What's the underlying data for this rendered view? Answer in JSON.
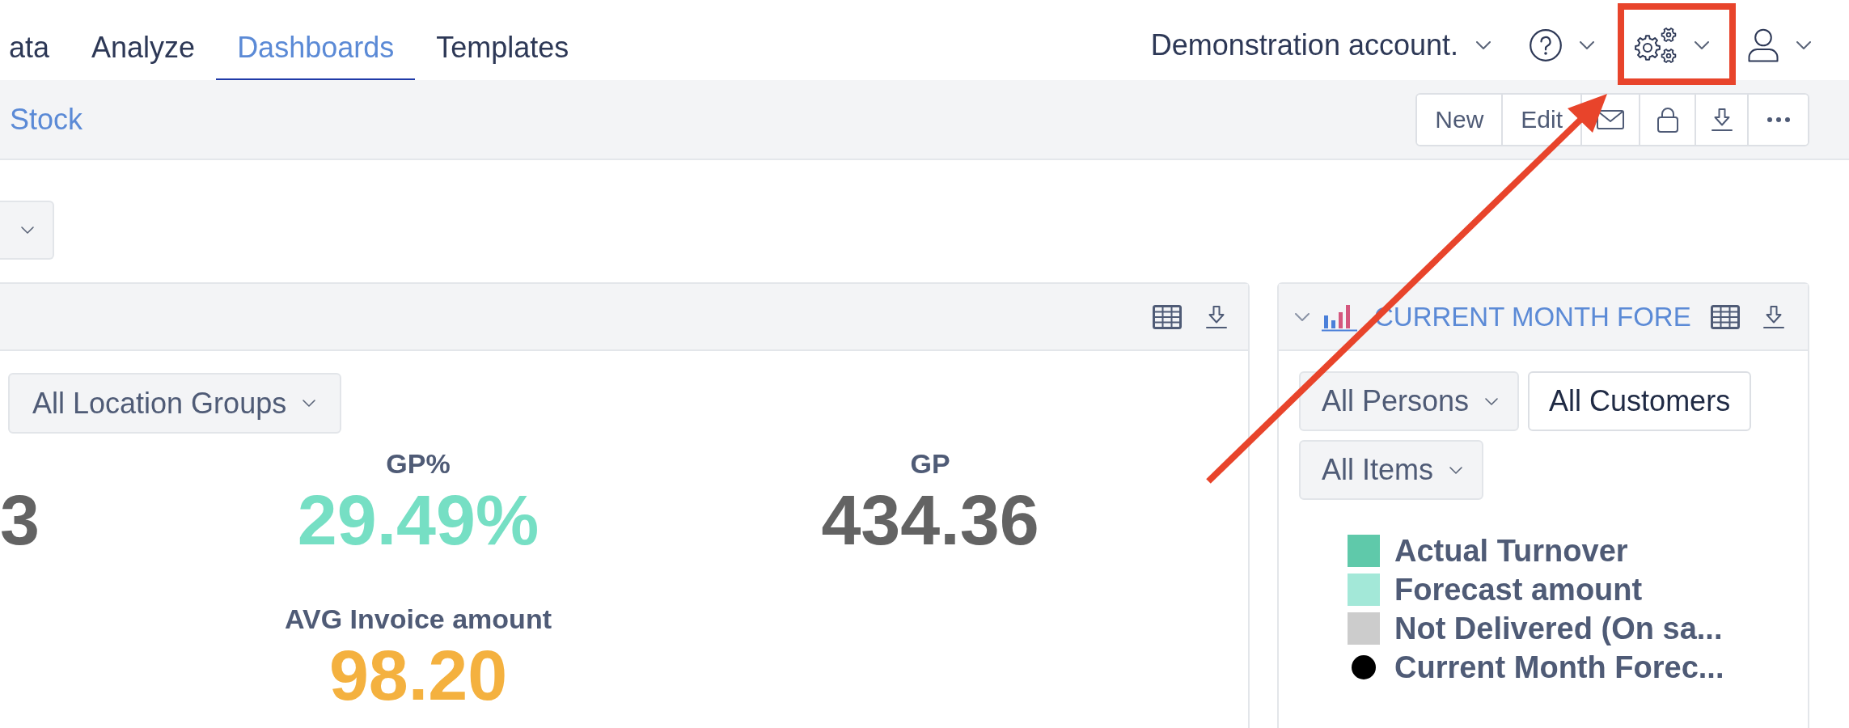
{
  "nav": {
    "tabs": [
      {
        "label": "ata",
        "selected": false
      },
      {
        "label": "Analyze",
        "selected": false
      },
      {
        "label": "Dashboards",
        "selected": true
      },
      {
        "label": "Templates",
        "selected": false
      }
    ],
    "account": "Demonstration account."
  },
  "toolbar": {
    "breadcrumb": "Stock",
    "buttons": [
      "New",
      "Edit"
    ]
  },
  "kpi_panel": {
    "filter": "All Location Groups",
    "tiles": [
      {
        "value": "3",
        "color": "#636363"
      },
      {
        "label": "GP%",
        "value": "29.49%",
        "color": "#76dfc4"
      },
      {
        "label": "GP",
        "value": "434.36",
        "color": "#636363"
      },
      {
        "label": "AVG Invoice amount",
        "value": "98.20",
        "color": "#f4b13f"
      }
    ]
  },
  "forecast_panel": {
    "title": "CURRENT MONTH FORE",
    "filters": [
      {
        "kind": "dropdown",
        "label": "All Persons"
      },
      {
        "kind": "button",
        "label": "All Customers"
      },
      {
        "kind": "dropdown",
        "label": "All Items"
      }
    ],
    "legend": [
      {
        "kind": "square",
        "label": "Actual Turnover",
        "color": "#5fc9aa"
      },
      {
        "kind": "square",
        "label": "Forecast amount",
        "color": "#a3e8d8"
      },
      {
        "kind": "square",
        "label": "Not Delivered (On sa...",
        "color": "#cccccc"
      },
      {
        "kind": "dot",
        "label": "Current Month Forec...",
        "color": "#000000"
      }
    ]
  },
  "annotation": {
    "highlight_box": true,
    "arrow": true
  }
}
